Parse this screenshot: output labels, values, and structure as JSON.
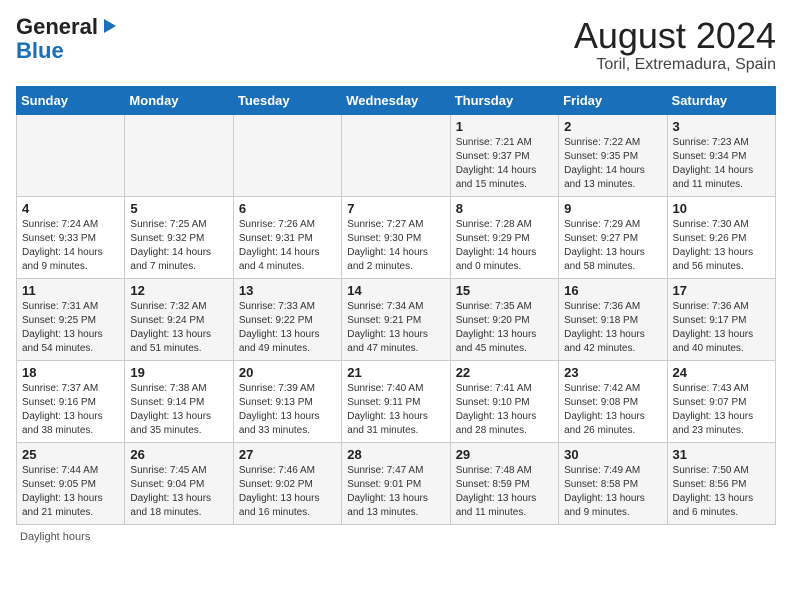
{
  "header": {
    "logo_general": "General",
    "logo_blue": "Blue",
    "title": "August 2024",
    "subtitle": "Toril, Extremadura, Spain"
  },
  "weekdays": [
    "Sunday",
    "Monday",
    "Tuesday",
    "Wednesday",
    "Thursday",
    "Friday",
    "Saturday"
  ],
  "weeks": [
    [
      {
        "day": "",
        "info": ""
      },
      {
        "day": "",
        "info": ""
      },
      {
        "day": "",
        "info": ""
      },
      {
        "day": "",
        "info": ""
      },
      {
        "day": "1",
        "info": "Sunrise: 7:21 AM\nSunset: 9:37 PM\nDaylight: 14 hours and 15 minutes."
      },
      {
        "day": "2",
        "info": "Sunrise: 7:22 AM\nSunset: 9:35 PM\nDaylight: 14 hours and 13 minutes."
      },
      {
        "day": "3",
        "info": "Sunrise: 7:23 AM\nSunset: 9:34 PM\nDaylight: 14 hours and 11 minutes."
      }
    ],
    [
      {
        "day": "4",
        "info": "Sunrise: 7:24 AM\nSunset: 9:33 PM\nDaylight: 14 hours and 9 minutes."
      },
      {
        "day": "5",
        "info": "Sunrise: 7:25 AM\nSunset: 9:32 PM\nDaylight: 14 hours and 7 minutes."
      },
      {
        "day": "6",
        "info": "Sunrise: 7:26 AM\nSunset: 9:31 PM\nDaylight: 14 hours and 4 minutes."
      },
      {
        "day": "7",
        "info": "Sunrise: 7:27 AM\nSunset: 9:30 PM\nDaylight: 14 hours and 2 minutes."
      },
      {
        "day": "8",
        "info": "Sunrise: 7:28 AM\nSunset: 9:29 PM\nDaylight: 14 hours and 0 minutes."
      },
      {
        "day": "9",
        "info": "Sunrise: 7:29 AM\nSunset: 9:27 PM\nDaylight: 13 hours and 58 minutes."
      },
      {
        "day": "10",
        "info": "Sunrise: 7:30 AM\nSunset: 9:26 PM\nDaylight: 13 hours and 56 minutes."
      }
    ],
    [
      {
        "day": "11",
        "info": "Sunrise: 7:31 AM\nSunset: 9:25 PM\nDaylight: 13 hours and 54 minutes."
      },
      {
        "day": "12",
        "info": "Sunrise: 7:32 AM\nSunset: 9:24 PM\nDaylight: 13 hours and 51 minutes."
      },
      {
        "day": "13",
        "info": "Sunrise: 7:33 AM\nSunset: 9:22 PM\nDaylight: 13 hours and 49 minutes."
      },
      {
        "day": "14",
        "info": "Sunrise: 7:34 AM\nSunset: 9:21 PM\nDaylight: 13 hours and 47 minutes."
      },
      {
        "day": "15",
        "info": "Sunrise: 7:35 AM\nSunset: 9:20 PM\nDaylight: 13 hours and 45 minutes."
      },
      {
        "day": "16",
        "info": "Sunrise: 7:36 AM\nSunset: 9:18 PM\nDaylight: 13 hours and 42 minutes."
      },
      {
        "day": "17",
        "info": "Sunrise: 7:36 AM\nSunset: 9:17 PM\nDaylight: 13 hours and 40 minutes."
      }
    ],
    [
      {
        "day": "18",
        "info": "Sunrise: 7:37 AM\nSunset: 9:16 PM\nDaylight: 13 hours and 38 minutes."
      },
      {
        "day": "19",
        "info": "Sunrise: 7:38 AM\nSunset: 9:14 PM\nDaylight: 13 hours and 35 minutes."
      },
      {
        "day": "20",
        "info": "Sunrise: 7:39 AM\nSunset: 9:13 PM\nDaylight: 13 hours and 33 minutes."
      },
      {
        "day": "21",
        "info": "Sunrise: 7:40 AM\nSunset: 9:11 PM\nDaylight: 13 hours and 31 minutes."
      },
      {
        "day": "22",
        "info": "Sunrise: 7:41 AM\nSunset: 9:10 PM\nDaylight: 13 hours and 28 minutes."
      },
      {
        "day": "23",
        "info": "Sunrise: 7:42 AM\nSunset: 9:08 PM\nDaylight: 13 hours and 26 minutes."
      },
      {
        "day": "24",
        "info": "Sunrise: 7:43 AM\nSunset: 9:07 PM\nDaylight: 13 hours and 23 minutes."
      }
    ],
    [
      {
        "day": "25",
        "info": "Sunrise: 7:44 AM\nSunset: 9:05 PM\nDaylight: 13 hours and 21 minutes."
      },
      {
        "day": "26",
        "info": "Sunrise: 7:45 AM\nSunset: 9:04 PM\nDaylight: 13 hours and 18 minutes."
      },
      {
        "day": "27",
        "info": "Sunrise: 7:46 AM\nSunset: 9:02 PM\nDaylight: 13 hours and 16 minutes."
      },
      {
        "day": "28",
        "info": "Sunrise: 7:47 AM\nSunset: 9:01 PM\nDaylight: 13 hours and 13 minutes."
      },
      {
        "day": "29",
        "info": "Sunrise: 7:48 AM\nSunset: 8:59 PM\nDaylight: 13 hours and 11 minutes."
      },
      {
        "day": "30",
        "info": "Sunrise: 7:49 AM\nSunset: 8:58 PM\nDaylight: 13 hours and 9 minutes."
      },
      {
        "day": "31",
        "info": "Sunrise: 7:50 AM\nSunset: 8:56 PM\nDaylight: 13 hours and 6 minutes."
      }
    ]
  ],
  "footer": "Daylight hours"
}
